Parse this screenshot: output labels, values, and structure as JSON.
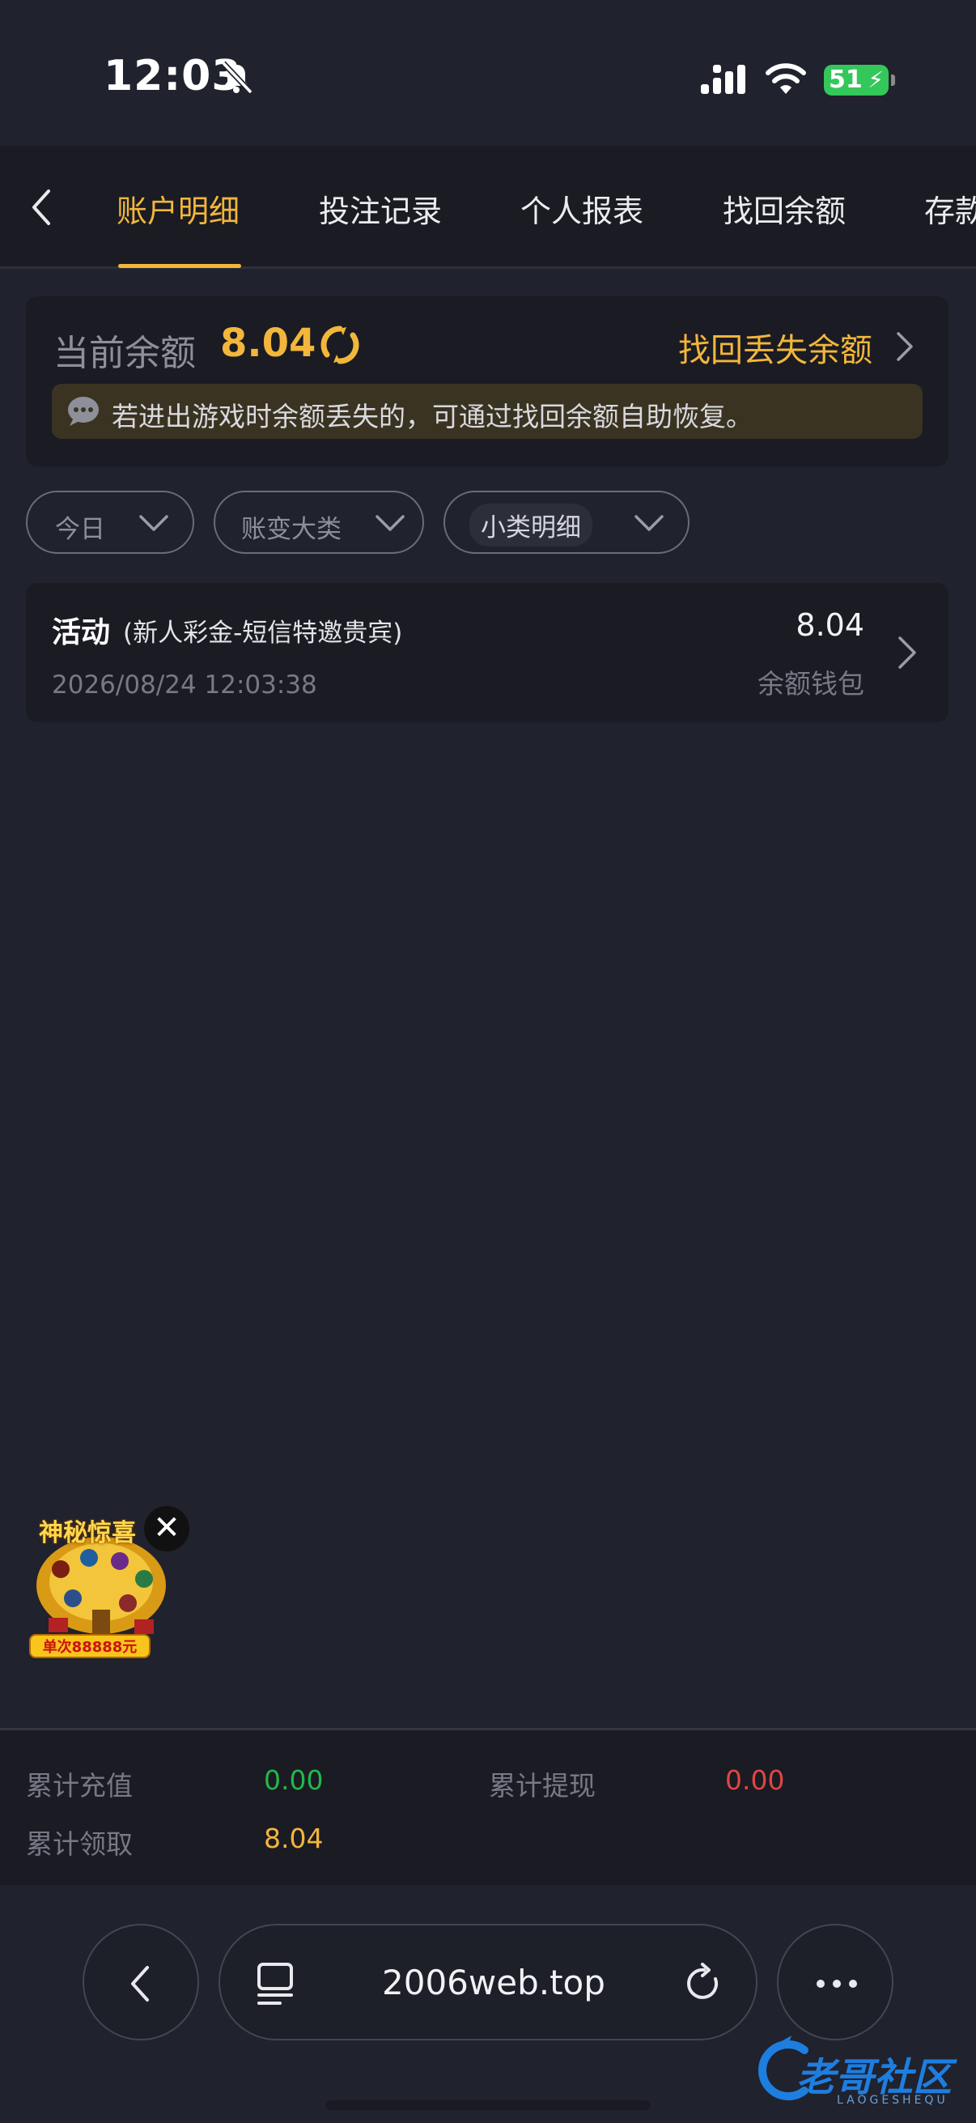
{
  "status_bar": {
    "time": "12:03",
    "battery": "51"
  },
  "tabs": [
    {
      "label": "账户明细",
      "active": true
    },
    {
      "label": "投注记录",
      "active": false
    },
    {
      "label": "个人报表",
      "active": false
    },
    {
      "label": "找回余额",
      "active": false
    },
    {
      "label": "存款",
      "active": false
    }
  ],
  "balance": {
    "label": "当前余额",
    "value": "8.04",
    "recover_link": "找回丢失余额",
    "notice": "若进出游戏时余额丢失的，可通过找回余额自助恢复。"
  },
  "filters": [
    {
      "label": "今日"
    },
    {
      "label": "账变大类"
    },
    {
      "label": "小类明细"
    }
  ],
  "records": [
    {
      "type": "活动",
      "desc": "(新人彩金-短信特邀贵宾)",
      "time": "2026/08/24 12:03:38",
      "amount": "8.04",
      "wallet": "余额钱包"
    }
  ],
  "promo": {
    "title": "神秘惊喜",
    "banner": "单次88888元",
    "close": "✕"
  },
  "summary": {
    "recharge_label": "累计充值",
    "recharge_value": "0.00",
    "withdraw_label": "累计提现",
    "withdraw_value": "0.00",
    "claim_label": "累计领取",
    "claim_value": "8.04"
  },
  "browser": {
    "url": "2006web.top"
  },
  "watermark": {
    "text": "老哥社区",
    "sub": "LAOGESHEQU"
  },
  "colors": {
    "accent": "#f2b63b",
    "positive": "#22b84a",
    "negative": "#e04545",
    "background": "#20222d",
    "card": "#1a1b23"
  }
}
